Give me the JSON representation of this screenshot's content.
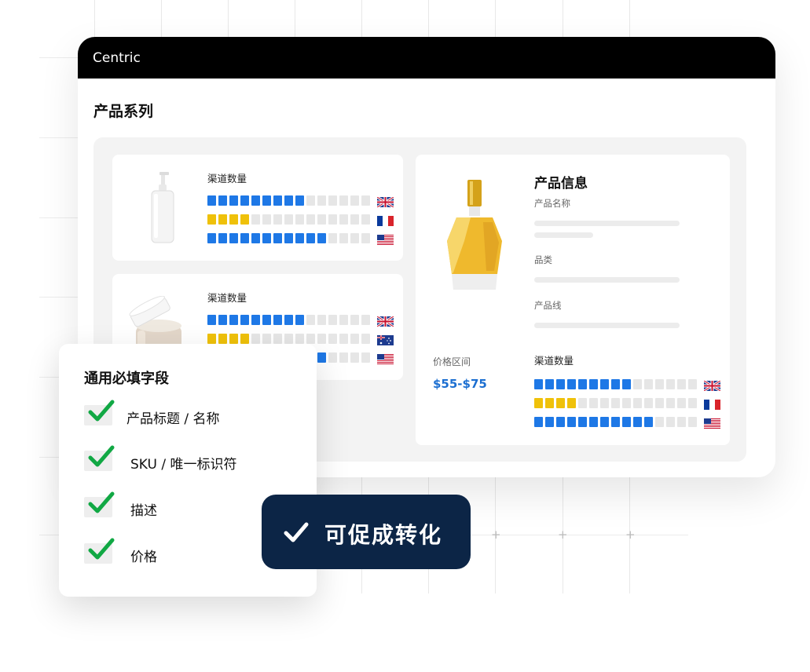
{
  "app": {
    "brand": "Centric"
  },
  "catalog": {
    "title": "产品系列",
    "cards": [
      {
        "product_icon": "pump-bottle-icon",
        "label": "渠道数量",
        "channels": [
          {
            "flag": "uk-flag-icon",
            "filled": 9,
            "total": 15,
            "color": "#1e78e6"
          },
          {
            "flag": "france-flag-icon",
            "filled": 4,
            "total": 15,
            "color": "#efc10a"
          },
          {
            "flag": "usa-flag-icon",
            "filled": 11,
            "total": 15,
            "color": "#1e78e6"
          }
        ]
      },
      {
        "product_icon": "cream-jar-icon",
        "label": "渠道数量",
        "channels": [
          {
            "flag": "uk-flag-icon",
            "filled": 9,
            "total": 15,
            "color": "#1e78e6"
          },
          {
            "flag": "australia-flag-icon",
            "filled": 4,
            "total": 15,
            "color": "#efc10a"
          },
          {
            "flag": "usa-flag-icon",
            "filled": 11,
            "total": 15,
            "color": "#1e78e6"
          }
        ]
      }
    ],
    "info": {
      "product_icon": "perfume-bottle-icon",
      "title": "产品信息",
      "fields": [
        "产品名称",
        "品类",
        "产品线"
      ],
      "price_label": "价格区间",
      "price_value": "$55-$75",
      "channels_label": "渠道数量",
      "channels": [
        {
          "flag": "uk-flag-icon",
          "filled": 9,
          "total": 15,
          "color": "#1e78e6"
        },
        {
          "flag": "france-flag-icon",
          "filled": 4,
          "total": 15,
          "color": "#efc10a"
        },
        {
          "flag": "usa-flag-icon",
          "filled": 11,
          "total": 15,
          "color": "#1e78e6"
        }
      ]
    }
  },
  "required": {
    "title": "通用必填字段",
    "items": [
      "产品标题 / 名称",
      "SKU / 唯一标识符",
      "描述",
      "价格"
    ]
  },
  "cta": {
    "label": "可促成转化",
    "icon": "checkmark-icon"
  },
  "colors": {
    "accent": "#1e78e6",
    "yellow": "#efc10a",
    "empty": "#e6e6e6",
    "cta_bg": "#0c2546",
    "check": "#11a844"
  }
}
